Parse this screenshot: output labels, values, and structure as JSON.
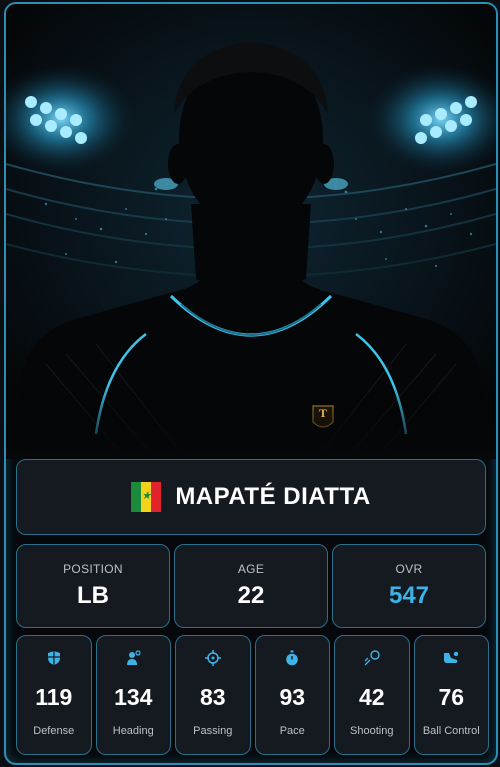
{
  "player": {
    "name": "MAPATÉ DIATTA",
    "flag_icon": "senegal-flag-icon",
    "jersey_badge": "T"
  },
  "info": [
    {
      "label": "POSITION",
      "value": "LB"
    },
    {
      "label": "AGE",
      "value": "22"
    },
    {
      "label": "OVR",
      "value": "547"
    }
  ],
  "stats": [
    {
      "icon": "shield-icon",
      "value": "119",
      "label": "Defense"
    },
    {
      "icon": "heading-player-icon",
      "value": "134",
      "label": "Heading"
    },
    {
      "icon": "crosshair-icon",
      "value": "83",
      "label": "Passing"
    },
    {
      "icon": "stopwatch-icon",
      "value": "93",
      "label": "Pace"
    },
    {
      "icon": "ball-shot-icon",
      "value": "42",
      "label": "Shooting"
    },
    {
      "icon": "boot-icon",
      "value": "76",
      "label": "Ball Control"
    }
  ],
  "colors": {
    "accent": "#3db3e6",
    "border": "#2a6f8c",
    "card_border": "#2c8fb3",
    "panel": "#151a20"
  }
}
